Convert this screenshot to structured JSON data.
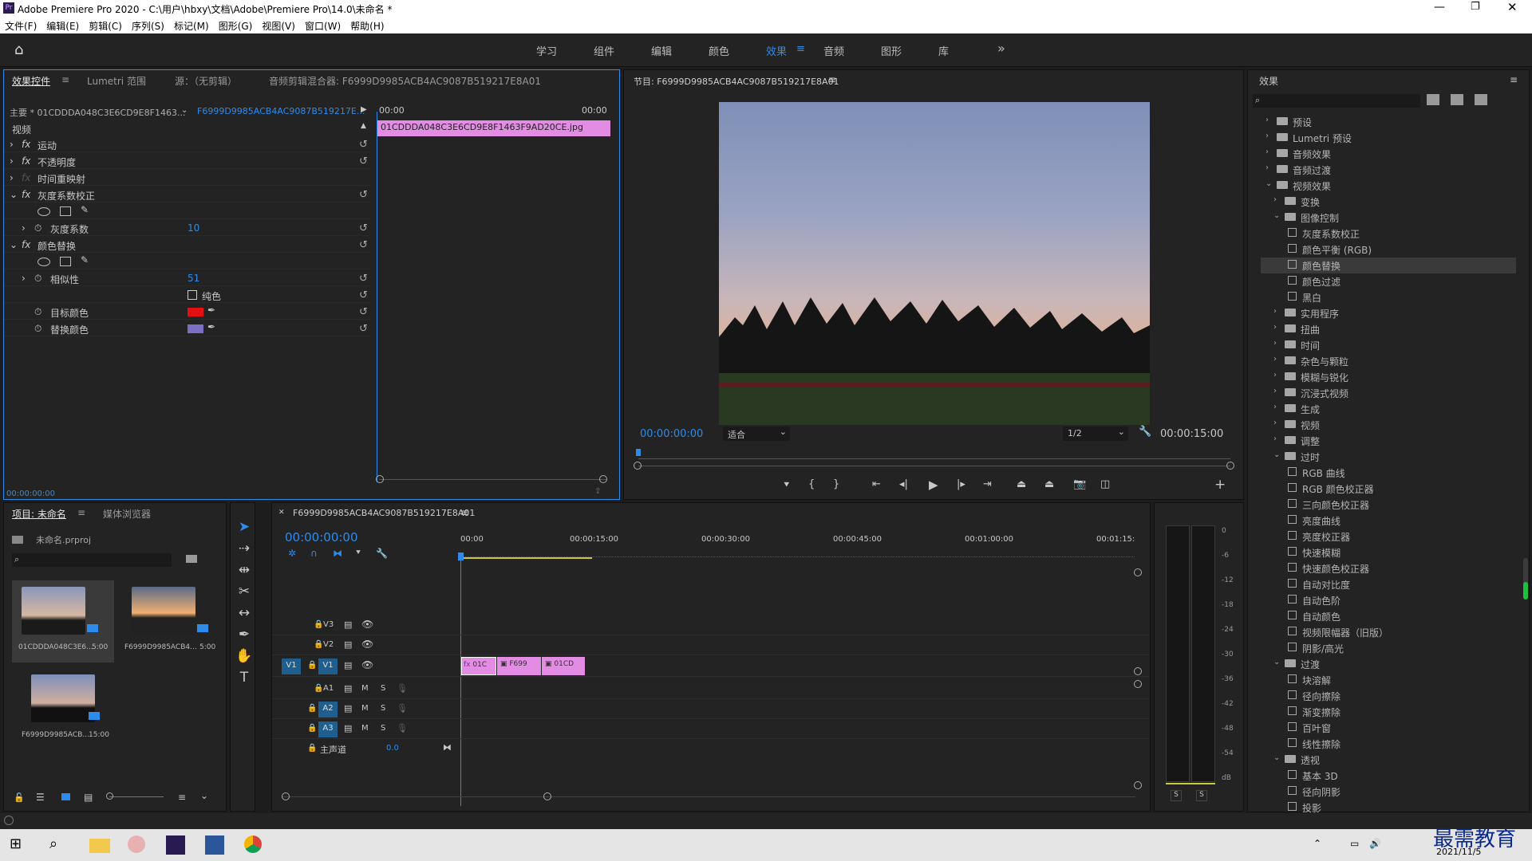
{
  "app": {
    "title": "Adobe Premiere Pro 2020 - C:\\用户\\hbxy\\文档\\Adobe\\Premiere Pro\\14.0\\未命名 *",
    "logo": "Pr"
  },
  "menu": [
    "文件(F)",
    "编辑(E)",
    "剪辑(C)",
    "序列(S)",
    "标记(M)",
    "图形(G)",
    "视图(V)",
    "窗口(W)",
    "帮助(H)"
  ],
  "workspaces": {
    "items": [
      "学习",
      "组件",
      "编辑",
      "颜色",
      "效果",
      "音频",
      "图形",
      "库"
    ],
    "active": "效果",
    "more": "»"
  },
  "effect_controls": {
    "tabs": [
      "效果控件",
      "Lumetri 范围",
      "源：（无剪辑）",
      "音频剪辑混合器: F6999D9985ACB4AC9087B519217E8A01"
    ],
    "master_label": "主要 * 01CDDDA048C3E6CD9E8F1463...",
    "sequence_label": "F6999D9985ACB4AC9087B519217E...",
    "time_start": "00:00",
    "time_end": "00:00",
    "clip_name": "01CDDDA048C3E6CD9E8F1463F9AD20CE.jpg",
    "section": "视频",
    "effects": [
      {
        "name": "运动"
      },
      {
        "name": "不透明度"
      },
      {
        "name": "时间重映射"
      },
      {
        "name": "灰度系数校正"
      },
      {
        "name": "灰度系数",
        "value": "10"
      },
      {
        "name": "颜色替换"
      },
      {
        "name": "相似性",
        "value": "51"
      },
      {
        "name": "纯色"
      },
      {
        "name": "目标颜色"
      },
      {
        "name": "替换颜色"
      }
    ],
    "target_color": "#e21010",
    "replace_color": "#7a6fc0",
    "timecode": "00:00:00:00"
  },
  "program": {
    "title": "节目: F6999D9985ACB4AC9087B519217E8A01",
    "timecode_left": "00:00:00:00",
    "zoom": "适合",
    "resolution": "1/2",
    "timecode_right": "00:00:15:00"
  },
  "effects_panel": {
    "title": "效果",
    "search_placeholder": "",
    "items": [
      {
        "label": "预设",
        "type": "folder",
        "level": 0,
        "open": false
      },
      {
        "label": "Lumetri 预设",
        "type": "folder",
        "level": 0,
        "open": false
      },
      {
        "label": "音频效果",
        "type": "folder",
        "level": 0,
        "open": false
      },
      {
        "label": "音频过渡",
        "type": "folder",
        "level": 0,
        "open": false
      },
      {
        "label": "视频效果",
        "type": "folder",
        "level": 0,
        "open": true
      },
      {
        "label": "变换",
        "type": "folder",
        "level": 1,
        "open": false
      },
      {
        "label": "图像控制",
        "type": "folder",
        "level": 1,
        "open": true
      },
      {
        "label": "灰度系数校正",
        "type": "fx",
        "level": 2
      },
      {
        "label": "颜色平衡 (RGB)",
        "type": "fx",
        "level": 2
      },
      {
        "label": "颜色替换",
        "type": "fx",
        "level": 2,
        "selected": true
      },
      {
        "label": "颜色过滤",
        "type": "fx",
        "level": 2
      },
      {
        "label": "黑白",
        "type": "fx",
        "level": 2
      },
      {
        "label": "实用程序",
        "type": "folder",
        "level": 1,
        "open": false
      },
      {
        "label": "扭曲",
        "type": "folder",
        "level": 1,
        "open": false
      },
      {
        "label": "时间",
        "type": "folder",
        "level": 1,
        "open": false
      },
      {
        "label": "杂色与颗粒",
        "type": "folder",
        "level": 1,
        "open": false
      },
      {
        "label": "模糊与锐化",
        "type": "folder",
        "level": 1,
        "open": false
      },
      {
        "label": "沉浸式视频",
        "type": "folder",
        "level": 1,
        "open": false
      },
      {
        "label": "生成",
        "type": "folder",
        "level": 1,
        "open": false
      },
      {
        "label": "视频",
        "type": "folder",
        "level": 1,
        "open": false
      },
      {
        "label": "调整",
        "type": "folder",
        "level": 1,
        "open": false
      },
      {
        "label": "过时",
        "type": "folder",
        "level": 1,
        "open": true
      },
      {
        "label": "RGB 曲线",
        "type": "fx",
        "level": 2
      },
      {
        "label": "RGB 颜色校正器",
        "type": "fx",
        "level": 2
      },
      {
        "label": "三向颜色校正器",
        "type": "fx",
        "level": 2
      },
      {
        "label": "亮度曲线",
        "type": "fx",
        "level": 2
      },
      {
        "label": "亮度校正器",
        "type": "fx",
        "level": 2
      },
      {
        "label": "快速模糊",
        "type": "fx",
        "level": 2
      },
      {
        "label": "快速颜色校正器",
        "type": "fx",
        "level": 2
      },
      {
        "label": "自动对比度",
        "type": "fx",
        "level": 2
      },
      {
        "label": "自动色阶",
        "type": "fx",
        "level": 2
      },
      {
        "label": "自动颜色",
        "type": "fx",
        "level": 2
      },
      {
        "label": "视频限幅器（旧版）",
        "type": "fx",
        "level": 2
      },
      {
        "label": "阴影/高光",
        "type": "fx",
        "level": 2
      },
      {
        "label": "过渡",
        "type": "folder",
        "level": 1,
        "open": true
      },
      {
        "label": "块溶解",
        "type": "fx",
        "level": 2
      },
      {
        "label": "径向擦除",
        "type": "fx",
        "level": 2
      },
      {
        "label": "渐变擦除",
        "type": "fx",
        "level": 2
      },
      {
        "label": "百叶窗",
        "type": "fx",
        "level": 2
      },
      {
        "label": "线性擦除",
        "type": "fx",
        "level": 2
      },
      {
        "label": "透视",
        "type": "folder",
        "level": 1,
        "open": true
      },
      {
        "label": "基本 3D",
        "type": "fx",
        "level": 2
      },
      {
        "label": "径向阴影",
        "type": "fx",
        "level": 2
      },
      {
        "label": "投影",
        "type": "fx",
        "level": 2
      }
    ]
  },
  "project": {
    "tabs": [
      "项目: 未命名",
      "媒体浏览器"
    ],
    "file": "未命名.prproj",
    "items": [
      {
        "name": "01CDDDA048C3E6...",
        "duration": "5:00"
      },
      {
        "name": "F6999D9985ACB4...",
        "duration": "5:00"
      },
      {
        "name": "F6999D9985ACB...",
        "duration": "15:00"
      }
    ]
  },
  "timeline": {
    "title": "F6999D9985ACB4AC9087B519217E8A01",
    "timecode": "00:00:00:00",
    "ruler": [
      "00:00",
      "00:00:15:00",
      "00:00:30:00",
      "00:00:45:00",
      "00:01:00:00",
      "00:01:15:"
    ],
    "video_tracks": [
      "V3",
      "V2",
      "V1"
    ],
    "audio_tracks": [
      "A1",
      "A2",
      "A3"
    ],
    "master": "主声道",
    "master_value": "0.0",
    "source_patch": "V1",
    "clips": [
      "01C",
      "F699",
      "01CD"
    ]
  },
  "meter": {
    "scale": [
      "0",
      "-6",
      "-12",
      "-18",
      "-24",
      "-30",
      "-36",
      "-42",
      "-48",
      "-54",
      "dB"
    ],
    "solo": [
      "S",
      "S"
    ]
  },
  "taskbar": {
    "date": "2021/11/5",
    "watermark": "最需教育"
  }
}
